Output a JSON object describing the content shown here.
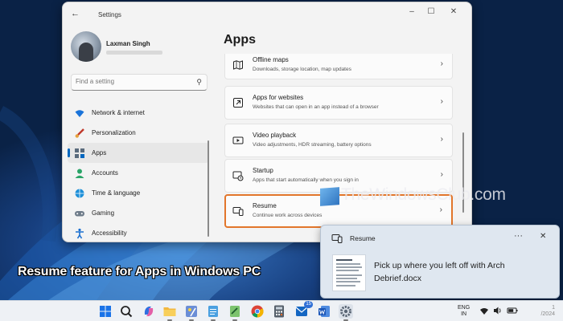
{
  "window": {
    "title": "Settings",
    "back_icon": "back-arrow-icon",
    "controls": {
      "minimize": "–",
      "maximize": "☐",
      "close": "✕"
    }
  },
  "user": {
    "name": "Laxman Singh"
  },
  "search": {
    "placeholder": "Find a setting",
    "icon": "search-icon"
  },
  "sidebar": {
    "items": [
      {
        "label": "Network & internet",
        "icon": "wifi-icon",
        "selected": false
      },
      {
        "label": "Personalization",
        "icon": "brush-icon",
        "selected": false
      },
      {
        "label": "Apps",
        "icon": "apps-icon",
        "selected": true
      },
      {
        "label": "Accounts",
        "icon": "person-icon",
        "selected": false
      },
      {
        "label": "Time & language",
        "icon": "globe-clock-icon",
        "selected": false
      },
      {
        "label": "Gaming",
        "icon": "gamepad-icon",
        "selected": false
      },
      {
        "label": "Accessibility",
        "icon": "accessibility-icon",
        "selected": false
      }
    ]
  },
  "main": {
    "title": "Apps",
    "cards": [
      {
        "title": "Offline maps",
        "desc": "Downloads, storage location, map updates",
        "icon": "map-icon"
      },
      {
        "title": "Apps for websites",
        "desc": "Websites that can open in an app instead of a browser",
        "icon": "open-in-app-icon"
      },
      {
        "title": "Video playback",
        "desc": "Video adjustments, HDR streaming, battery options",
        "icon": "video-icon"
      },
      {
        "title": "Startup",
        "desc": "Apps that start automatically when you sign in",
        "icon": "startup-icon"
      },
      {
        "title": "Resume",
        "desc": "Continue work across devices",
        "icon": "resume-icon",
        "highlighted": true
      }
    ]
  },
  "watermark": {
    "text": "TheWindowsClub.com"
  },
  "caption": {
    "text": "Resume feature for Apps in Windows PC"
  },
  "toast": {
    "app": "Resume",
    "message": "Pick up where you left off with Arch Debrief.docx",
    "more": "···",
    "close": "✕"
  },
  "taskbar": {
    "apps": [
      "windows-start-icon",
      "search-icon",
      "copilot-icon",
      "file-explorer-icon",
      "paint-icon",
      "notepad-icon",
      "chrome-icon",
      "calculator-icon",
      "outlook-icon",
      "word-icon",
      "settings-icon"
    ],
    "outlook_badge": "15",
    "language": {
      "line1": "ENG",
      "line2": "IN"
    },
    "clock": {
      "time": "1",
      "date": "/2024"
    },
    "colors": {
      "accent": "#0067c0",
      "highlight_border": "#e2762b"
    }
  }
}
